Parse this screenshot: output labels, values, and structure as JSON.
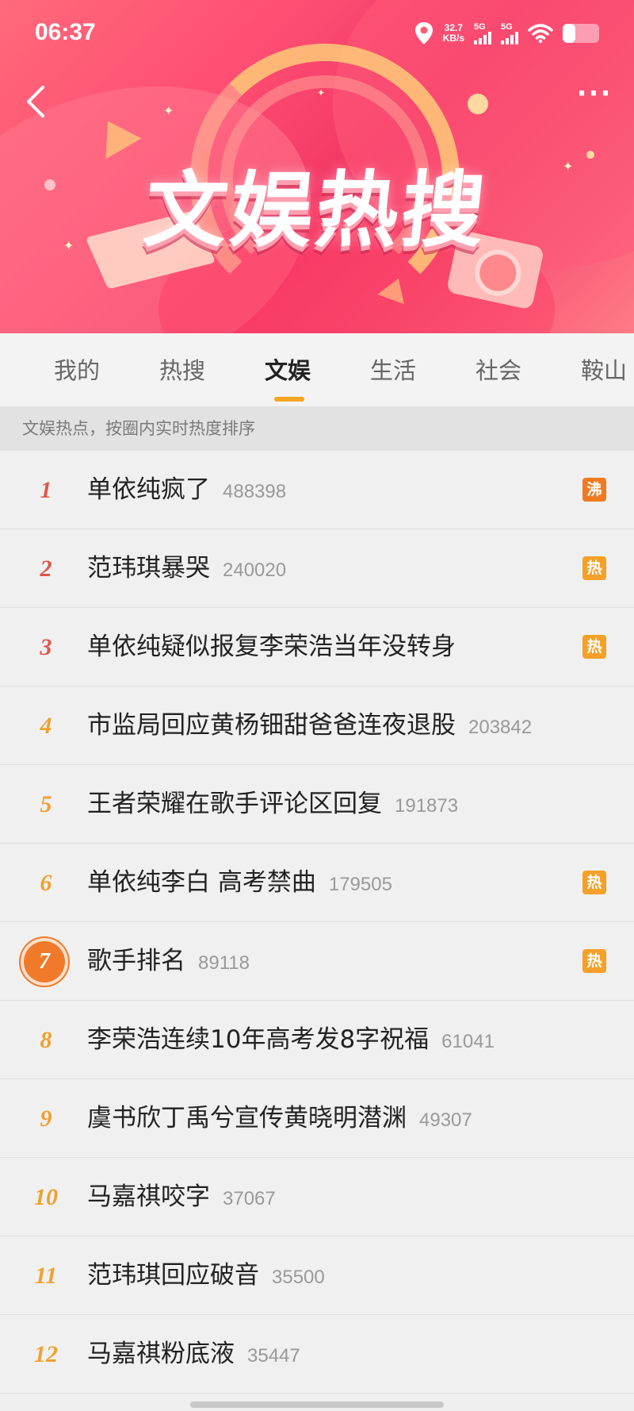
{
  "status_bar": {
    "time": "06:37",
    "speed_value": "32.7",
    "speed_unit": "KB/s",
    "signal1_label": "5G",
    "signal2_label": "5G"
  },
  "banner": {
    "title": "文娱热搜",
    "accent_color": "#f23766"
  },
  "header": {
    "more_label": "···"
  },
  "tabs": [
    {
      "label": "我的"
    },
    {
      "label": "热搜"
    },
    {
      "label": "文娱",
      "active": true
    },
    {
      "label": "生活"
    },
    {
      "label": "社会"
    },
    {
      "label": "鞍山"
    }
  ],
  "subheader": "文娱热点，按圈内实时热度排序",
  "items": [
    {
      "rank": "1",
      "title": "单依纯疯了",
      "count": "488398",
      "tag": "沸"
    },
    {
      "rank": "2",
      "title": "范玮琪暴哭",
      "count": "240020",
      "tag": "热"
    },
    {
      "rank": "3",
      "title": "单依纯疑似报复李荣浩当年没转身",
      "count": "",
      "tag": "热"
    },
    {
      "rank": "4",
      "title": "市监局回应黄杨钿甜爸爸连夜退股",
      "count": "203842",
      "tag": ""
    },
    {
      "rank": "5",
      "title": "王者荣耀在歌手评论区回复",
      "count": "191873",
      "tag": ""
    },
    {
      "rank": "6",
      "title": "单依纯李白 高考禁曲",
      "count": "179505",
      "tag": "热"
    },
    {
      "rank": "7",
      "title": "歌手排名",
      "count": "89118",
      "tag": "热"
    },
    {
      "rank": "8",
      "title": "李荣浩连续10年高考发8字祝福",
      "count": "61041",
      "tag": ""
    },
    {
      "rank": "9",
      "title": "虞书欣丁禹兮宣传黄晓明潜渊",
      "count": "49307",
      "tag": ""
    },
    {
      "rank": "10",
      "title": "马嘉祺咬字",
      "count": "37067",
      "tag": ""
    },
    {
      "rank": "11",
      "title": "范玮琪回应破音",
      "count": "35500",
      "tag": ""
    },
    {
      "rank": "12",
      "title": "马嘉祺粉底液",
      "count": "35447",
      "tag": ""
    }
  ]
}
